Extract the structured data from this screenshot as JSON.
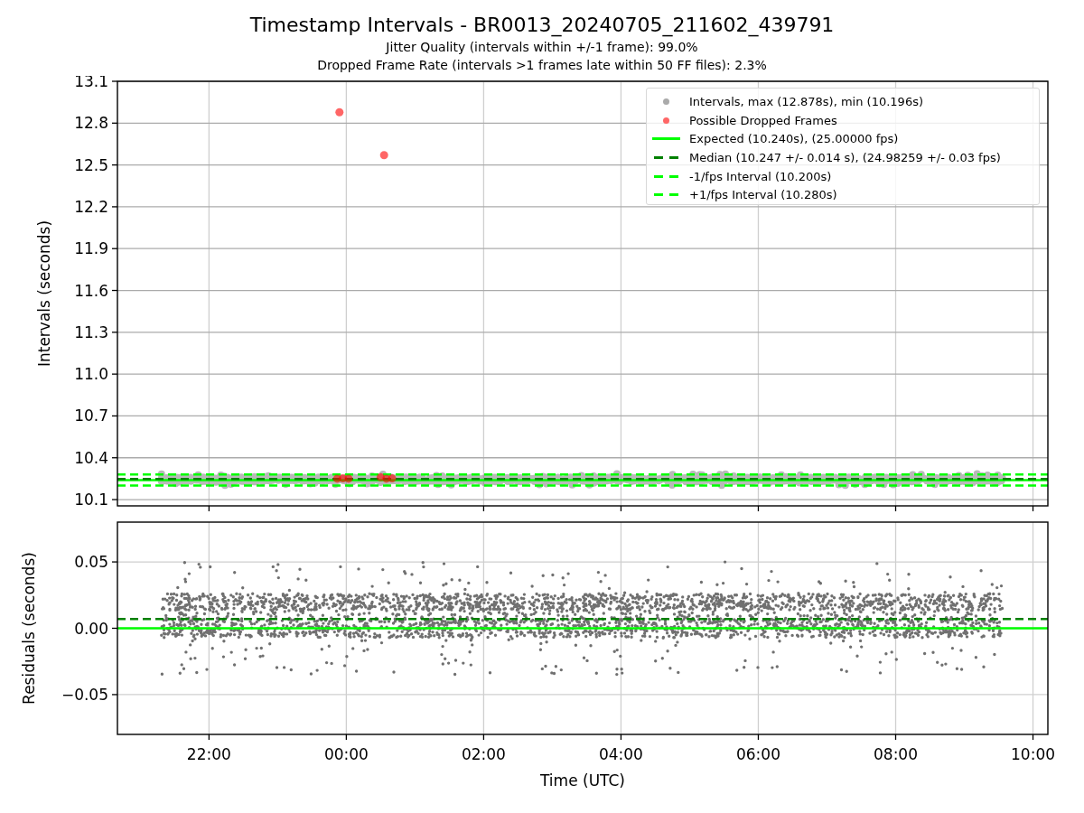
{
  "title": "Timestamp Intervals - BR0013_20240705_211602_439791",
  "subtitles": [
    "Jitter Quality (intervals within +/-1 frame): 99.0%",
    "Dropped Frame Rate (intervals >1 frames late within 50 FF files): 2.3%"
  ],
  "panels": [
    {
      "legend": [
        {
          "label": "Intervals, max (12.878s), min (10.196s)",
          "color": "#aaaaaa",
          "kind": "dot"
        },
        {
          "label": "Possible Dropped Frames",
          "color": "#ff6666",
          "kind": "dot"
        },
        {
          "label": "Expected (10.240s), (25.00000 fps)",
          "color": "#00ff00",
          "kind": "line"
        },
        {
          "label": "Median (10.247 +/- 0.014 s), (24.98259 +/- 0.03 fps)",
          "color": "#008000",
          "kind": "dash"
        },
        {
          "label": "-1/fps Interval (10.200s)",
          "color": "#00ff00",
          "kind": "dash"
        },
        {
          "label": "+1/fps Interval (10.280s)",
          "color": "#00ff00",
          "kind": "dash"
        }
      ],
      "chart_data": {
        "type": "scatter",
        "ylabel": "Intervals (seconds)",
        "xlim": [
          "2024-07-05T20:40:00Z",
          "2024-07-06T10:13:00Z"
        ],
        "ylim": [
          10.055,
          13.1
        ],
        "grid": true,
        "x": [
          "2024-07-05T23:54:00Z",
          "2024-07-06T00:33:00Z",
          "2024-07-05T23:52:00Z",
          "2024-07-05T23:57:00Z",
          "2024-07-06T00:02:00Z",
          "2024-07-06T00:30:00Z",
          "2024-07-06T00:35:00Z",
          "2024-07-06T00:40:00Z"
        ],
        "yticks": [
          {
            "value": 10.1,
            "label": "10.1"
          },
          {
            "value": 10.4,
            "label": "10.4"
          },
          {
            "value": 10.7,
            "label": "10.7"
          },
          {
            "value": 11.0,
            "label": "11.0"
          },
          {
            "value": 11.3,
            "label": "11.3"
          },
          {
            "value": 11.6,
            "label": "11.6"
          },
          {
            "value": 11.9,
            "label": "11.9"
          },
          {
            "value": 12.2,
            "label": "12.2"
          },
          {
            "value": 12.5,
            "label": "12.5"
          },
          {
            "value": 12.8,
            "label": "12.8"
          },
          {
            "value": 13.1,
            "label": "13.1"
          }
        ],
        "series": [
          {
            "color": "#ff0000",
            "values": [
              12.878,
              12.57,
              10.25,
              10.252,
              10.25,
              10.26,
              10.25,
              10.252
            ]
          }
        ],
        "ref_lines": [
          {
            "axis": "y",
            "value": 10.24,
            "color": "#00ff00"
          },
          {
            "axis": "y",
            "value": 10.247,
            "color": "#008000"
          },
          {
            "axis": "y",
            "value": 10.2,
            "color": "#00ff00"
          },
          {
            "axis": "y",
            "value": 10.28,
            "color": "#00ff00"
          }
        ]
      }
    },
    {
      "chart_data": {
        "type": "scatter",
        "xlabel": "Time (UTC)",
        "ylabel": "Residuals (seconds)",
        "xlim": [
          "2024-07-05T20:40:00Z",
          "2024-07-06T10:13:00Z"
        ],
        "ylim": [
          -0.08,
          0.08
        ],
        "grid": true,
        "xticks": [
          {
            "value": "2024-07-05T22:00:00Z",
            "label": "22:00"
          },
          {
            "value": "2024-07-06T00:00:00Z",
            "label": "00:00"
          },
          {
            "value": "2024-07-06T02:00:00Z",
            "label": "02:00"
          },
          {
            "value": "2024-07-06T04:00:00Z",
            "label": "04:00"
          },
          {
            "value": "2024-07-06T06:00:00Z",
            "label": "06:00"
          },
          {
            "value": "2024-07-06T08:00:00Z",
            "label": "08:00"
          },
          {
            "value": "2024-07-06T10:00:00Z",
            "label": "10:00"
          }
        ],
        "yticks": [
          {
            "value": 0.05,
            "label": "0.05"
          },
          {
            "value": 0,
            "label": "0.00"
          },
          {
            "value": -0.05,
            "label": "−0.05"
          }
        ],
        "ref_lines": [
          {
            "axis": "y",
            "value": 0,
            "color": "#00ff00"
          },
          {
            "axis": "y",
            "value": 0.007,
            "color": "#008000"
          }
        ]
      }
    }
  ]
}
